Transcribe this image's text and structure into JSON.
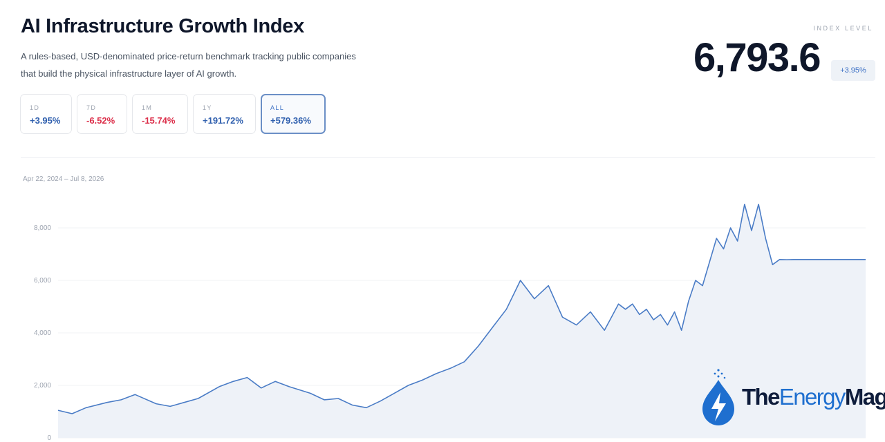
{
  "header": {
    "title": "AI Infrastructure Growth Index",
    "description_line1": "A rules-based, USD-denominated price-return benchmark tracking public companies",
    "description_line2": "that build the physical infrastructure layer of AI growth."
  },
  "index": {
    "label": "INDEX LEVEL",
    "value": "6,793.6",
    "change": "+3.95%"
  },
  "periods": [
    {
      "label": "1D",
      "value": "+3.95%",
      "sign": "pos"
    },
    {
      "label": "7D",
      "value": "-6.52%",
      "sign": "neg"
    },
    {
      "label": "1M",
      "value": "-15.74%",
      "sign": "neg"
    },
    {
      "label": "1Y",
      "value": "+191.72%",
      "sign": "pos"
    },
    {
      "label": "ALL",
      "value": "+579.36%",
      "sign": "pos",
      "active": true
    }
  ],
  "date_range": "Apr 22, 2024 – Jul 8, 2026",
  "colors": {
    "line": "#4a7cc6",
    "area": "#eef2f8",
    "positive": "#2f5fae",
    "negative": "#dc2f4a"
  },
  "chart_data": {
    "type": "area",
    "title": "",
    "xlabel": "",
    "ylabel": "",
    "x_range": [
      "2024-04-22",
      "2026-07-08"
    ],
    "ylim": [
      0,
      9000
    ],
    "yticks": [
      "0",
      "2,000",
      "4,000",
      "6,000",
      "8,000"
    ],
    "ytick_values": [
      0,
      2000,
      4000,
      6000,
      8000
    ],
    "grid": true,
    "legend": "none",
    "series": [
      {
        "x": [
          "2024-04-22",
          "2024-05-06",
          "2024-05-20",
          "2024-06-10",
          "2024-06-24",
          "2024-07-08",
          "2024-07-29",
          "2024-08-12",
          "2024-08-26",
          "2024-09-09",
          "2024-09-30",
          "2024-10-14",
          "2024-10-28",
          "2024-11-11",
          "2024-11-25",
          "2024-12-09",
          "2024-12-30",
          "2025-01-13",
          "2025-01-27",
          "2025-02-10",
          "2025-02-24",
          "2025-03-10",
          "2025-03-24",
          "2025-04-07",
          "2025-04-21",
          "2025-05-05",
          "2025-05-19",
          "2025-06-02",
          "2025-06-16",
          "2025-06-30",
          "2025-07-14",
          "2025-07-28",
          "2025-08-11",
          "2025-08-25",
          "2025-09-08",
          "2025-09-22",
          "2025-10-06",
          "2025-10-20",
          "2025-10-27",
          "2025-11-03",
          "2025-11-10",
          "2025-11-17",
          "2025-11-24",
          "2025-12-01",
          "2025-12-08",
          "2025-12-15",
          "2025-12-22",
          "2025-12-29",
          "2026-01-05",
          "2026-01-12",
          "2026-01-19",
          "2026-01-26",
          "2026-02-02",
          "2026-02-09",
          "2026-02-16",
          "2026-02-23",
          "2026-03-02",
          "2026-03-09",
          "2026-03-16",
          "2026-03-23",
          "2026-03-30",
          "2026-04-06",
          "2026-04-13",
          "2026-04-20",
          "2026-04-27",
          "2026-05-04",
          "2026-05-11",
          "2026-05-18",
          "2026-05-25",
          "2026-06-01",
          "2026-06-08",
          "2026-06-15",
          "2026-06-22",
          "2026-06-29",
          "2026-07-06",
          "2026-07-08"
        ],
        "values": [
          1050,
          920,
          1150,
          1350,
          1450,
          1650,
          1300,
          1200,
          1350,
          1500,
          1950,
          2150,
          2300,
          1900,
          2150,
          1950,
          1700,
          1450,
          1500,
          1250,
          1150,
          1400,
          1700,
          2000,
          2200,
          2450,
          2650,
          2900,
          3500,
          4200,
          4900,
          6000,
          5300,
          5800,
          4600,
          4300,
          4800,
          4100,
          4600,
          5100,
          4900,
          5100,
          4700,
          4900,
          4500,
          4700,
          4300,
          4800,
          4100,
          5200,
          6000,
          5800,
          6700,
          7600,
          7200,
          8000,
          7500,
          8900,
          7900,
          8900,
          7600,
          6600,
          6793.6,
          6790,
          6795,
          6793.6,
          6793.6,
          6793.6,
          6793.6,
          6793.6,
          6793.6,
          6793.6,
          6793.6,
          6793.6,
          6793.6,
          6793.6
        ]
      }
    ]
  },
  "watermark": {
    "text_part1": "The",
    "text_part2": "Energy",
    "text_part3": "Mag",
    "icon": "lightning-drop-icon"
  }
}
